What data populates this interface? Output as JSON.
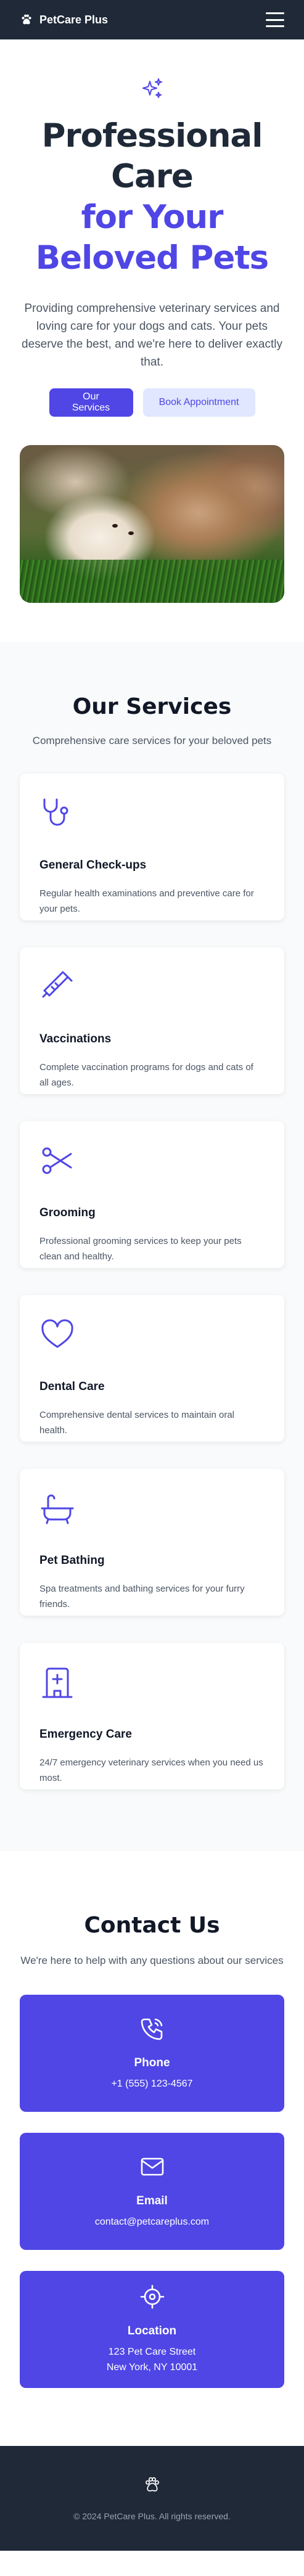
{
  "nav": {
    "brand": "PetCare Plus",
    "brand_icon": "paw-icon",
    "menu_icon": "hamburger-menu-icon"
  },
  "hero": {
    "icon": "sparkles-icon",
    "title_line1": "Professional",
    "title_line2": "Care",
    "title_accent_line1": "for Your",
    "title_accent_line2": "Beloved Pets",
    "description": "Providing comprehensive veterinary services and loving care for your dogs and cats. Your pets deserve the best, and we're here to deliver exactly that.",
    "primary_button": "Our Services",
    "secondary_button": "Book Appointment"
  },
  "services": {
    "title": "Our Services",
    "subtitle": "Comprehensive care services for your beloved pets",
    "items": [
      {
        "icon": "stethoscope-icon",
        "title": "General Check-ups",
        "text": "Regular health examinations and preventive care for your pets."
      },
      {
        "icon": "syringe-icon",
        "title": "Vaccinations",
        "text": "Complete vaccination programs for dogs and cats of all ages."
      },
      {
        "icon": "scissors-icon",
        "title": "Grooming",
        "text": "Professional grooming services to keep your pets clean and healthy."
      },
      {
        "icon": "heart-icon",
        "title": "Dental Care",
        "text": "Comprehensive dental services to maintain oral health."
      },
      {
        "icon": "bathtub-icon",
        "title": "Pet Bathing",
        "text": "Spa treatments and bathing services for your furry friends."
      },
      {
        "icon": "hospital-icon",
        "title": "Emergency Care",
        "text": "24/7 emergency veterinary services when you need us most."
      }
    ]
  },
  "contact": {
    "title": "Contact Us",
    "subtitle": "We're here to help with any questions about our services",
    "items": [
      {
        "icon": "phone-icon",
        "title": "Phone",
        "line1": "+1 (555) 123-4567",
        "line2": ""
      },
      {
        "icon": "mail-icon",
        "title": "Email",
        "line1": "contact@petcareplus.com",
        "line2": ""
      },
      {
        "icon": "location-icon",
        "title": "Location",
        "line1": "123 Pet Care Street",
        "line2": "New York, NY 10001"
      }
    ]
  },
  "footer": {
    "icon": "paw-icon",
    "copyright": "© 2024 PetCare Plus. All rights reserved."
  },
  "colors": {
    "accent": "#4f46e5",
    "accent_light": "#e0e7ff",
    "dark": "#1f2937",
    "muted": "#4b5563"
  }
}
